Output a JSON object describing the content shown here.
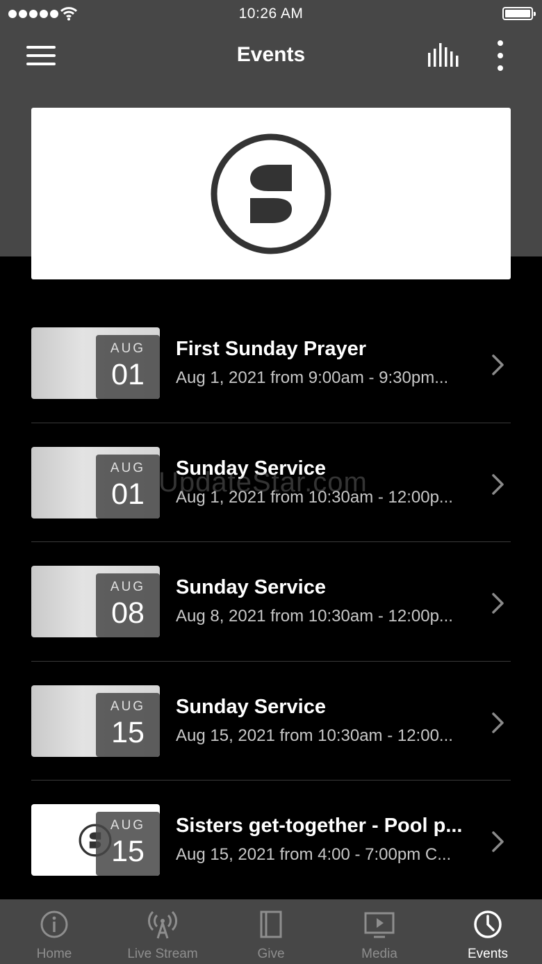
{
  "status_bar": {
    "time": "10:26 AM"
  },
  "nav": {
    "title": "Events"
  },
  "events": [
    {
      "month": "AUG",
      "day": "01",
      "title": "First Sunday Prayer",
      "subtitle": "Aug 1, 2021 from 9:00am - 9:30pm...",
      "thumb": "brick"
    },
    {
      "month": "AUG",
      "day": "01",
      "title": "Sunday Service",
      "subtitle": "Aug 1, 2021 from 10:30am - 12:00p...",
      "thumb": "brick"
    },
    {
      "month": "AUG",
      "day": "08",
      "title": "Sunday Service",
      "subtitle": "Aug 8, 2021 from 10:30am - 12:00p...",
      "thumb": "brick"
    },
    {
      "month": "AUG",
      "day": "15",
      "title": "Sunday Service",
      "subtitle": "Aug 15, 2021 from 10:30am - 12:00...",
      "thumb": "brick"
    },
    {
      "month": "AUG",
      "day": "15",
      "title": "Sisters get-together - Pool p...",
      "subtitle": "Aug 15, 2021 from 4:00 - 7:00pm C...",
      "thumb": "logo"
    }
  ],
  "watermark": "UpdateStar.com",
  "tabs": [
    {
      "label": "Home",
      "icon": "info-icon",
      "active": false
    },
    {
      "label": "Live Stream",
      "icon": "broadcast-icon",
      "active": false
    },
    {
      "label": "Give",
      "icon": "book-icon",
      "active": false
    },
    {
      "label": "Media",
      "icon": "tv-play-icon",
      "active": false
    },
    {
      "label": "Events",
      "icon": "clock-icon",
      "active": true
    }
  ],
  "colors": {
    "header_bg": "#474747",
    "list_bg": "#000000",
    "tab_active": "#ffffff",
    "tab_inactive": "#8e8e8e"
  }
}
